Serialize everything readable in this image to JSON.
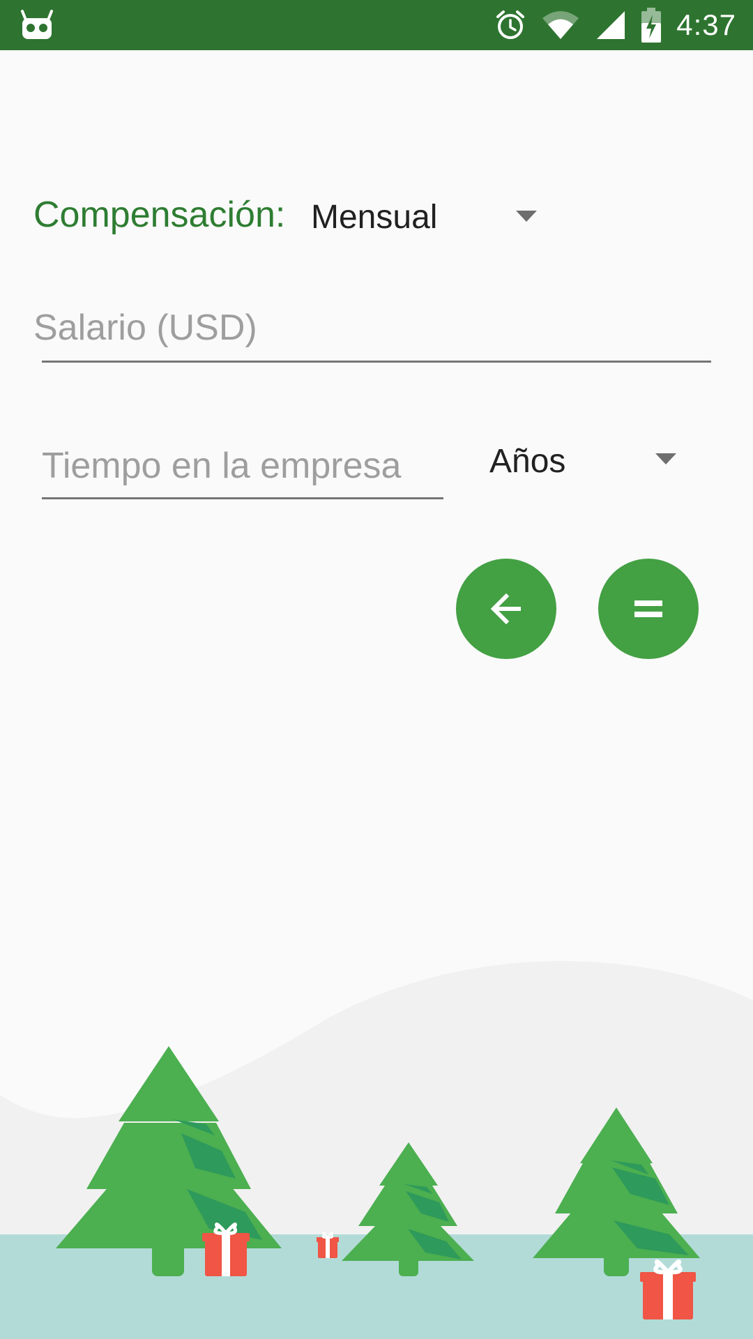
{
  "status_bar": {
    "time": "4:37",
    "icons": [
      "android-notification-icon",
      "alarm-icon",
      "wifi-icon",
      "cell-signal-icon",
      "battery-charging-icon"
    ],
    "background_color": "#2e7430"
  },
  "form": {
    "compensation_label": "Compensación:",
    "compensation_value": "Mensual",
    "salary_placeholder": "Salario (USD)",
    "tenure_placeholder": "Tiempo en la empresa",
    "tenure_unit_value": "Años"
  },
  "buttons": {
    "back_icon": "arrow-left-icon",
    "equals_icon": "equals-icon",
    "color": "#43a043"
  },
  "theme": {
    "accent": "#2e7d32",
    "tree_green": "#4caf50",
    "tree_shade": "#2e9a5b",
    "gift_red": "#f05545",
    "ground": "#b2dbd8",
    "hill": "#f1f1f1"
  }
}
